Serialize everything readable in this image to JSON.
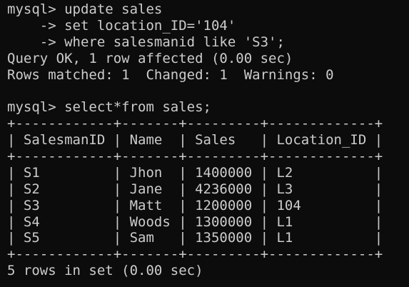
{
  "terminal": {
    "lines": [
      "mysql> update sales",
      "    -> set location_ID='104'",
      "    -> where salesmanid like 'S3';",
      "Query OK, 1 row affected (0.00 sec)",
      "Rows matched: 1  Changed: 1  Warnings: 0",
      "",
      "mysql> select*from sales;",
      "+------------+-------+---------+-------------+",
      "| SalesmanID | Name  | Sales   | Location_ID |",
      "+------------+-------+---------+-------------+",
      "| S1         | Jhon  | 1400000 | L2          |",
      "| S2         | Jane  | 4236000 | L3          |",
      "| S3         | Matt  | 1200000 | 104         |",
      "| S4         | Woods | 1300000 | L1          |",
      "| S5         | Sam   | 1350000 | L1          |",
      "+------------+-------+---------+-------------+",
      "5 rows in set (0.00 sec)"
    ]
  },
  "colors": {
    "background": "#0c0c0c",
    "text": "#cccccc"
  }
}
